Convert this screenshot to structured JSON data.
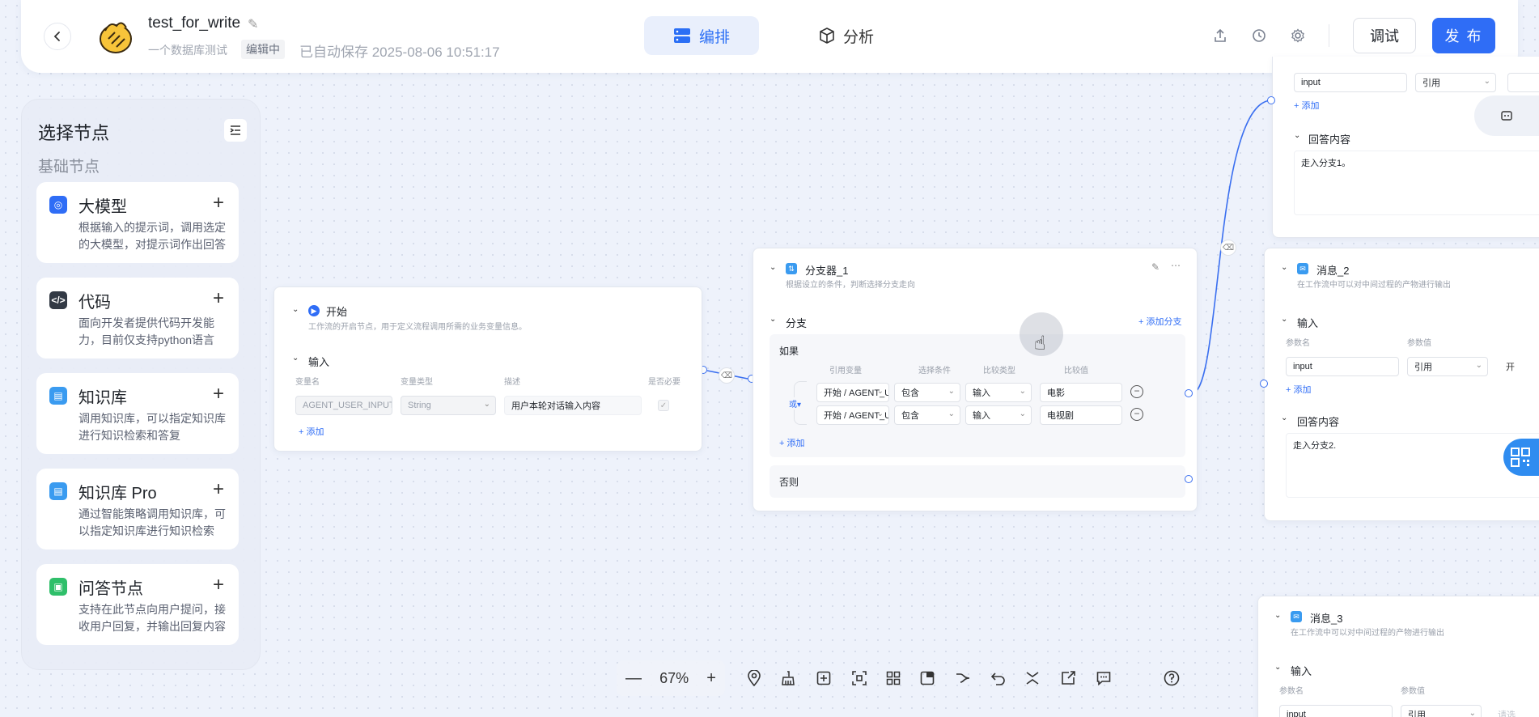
{
  "header": {
    "app_title": "test_for_write",
    "app_desc": "一个数据库测试",
    "status": "编辑中",
    "autosave": "已自动保存 2025-08-06 10:51:17",
    "tabs": [
      {
        "label": "编排",
        "active": true
      },
      {
        "label": "分析",
        "active": false
      }
    ],
    "debug_label": "调试",
    "publish_label": "发 布",
    "accent": "#2f6df6"
  },
  "panel": {
    "title": "选择节点",
    "section": "基础节点",
    "nodes": [
      {
        "name": "大模型",
        "desc": "根据输入的提示词，调用选定的大模型，对提示词作出回答",
        "icon": "llm-icon",
        "color": "#2f6df6"
      },
      {
        "name": "代码",
        "desc": "面向开发者提供代码开发能力，目前仅支持python语言",
        "icon": "code-icon",
        "color": "#333a45"
      },
      {
        "name": "知识库",
        "desc": "调用知识库，可以指定知识库进行知识检索和答复",
        "icon": "knowledge-icon",
        "color": "#3a9bf0"
      },
      {
        "name": "知识库 Pro",
        "desc": "通过智能策略调用知识库，可以指定知识库进行知识检索",
        "icon": "knowledge-pro-icon",
        "color": "#3a9bf0"
      },
      {
        "name": "问答节点",
        "desc": "支持在此节点向用户提问，接收用户回复，并输出回复内容",
        "icon": "qa-icon",
        "color": "#2fbf6a"
      }
    ]
  },
  "start_node": {
    "title": "开始",
    "desc": "工作流的开启节点，用于定义流程调用所需的业务变量信息。",
    "section": "输入",
    "headers": [
      "变量名",
      "变量类型",
      "描述",
      "是否必要"
    ],
    "row": {
      "name": "AGENT_USER_INPUT",
      "type": "String",
      "desc": "用户本轮对话输入内容"
    },
    "add": "添加"
  },
  "branch_node": {
    "title": "分支器_1",
    "desc": "根据设立的条件，判断选择分支走向",
    "section": "分支",
    "add_branch": "添加分支",
    "if_label": "如果",
    "headers": [
      "引用变量",
      "选择条件",
      "比较类型",
      "比较值"
    ],
    "logic": "或",
    "conditions": [
      {
        "var": "开始 / AGENT_USER_INPUT",
        "op": "包含",
        "type": "输入",
        "value": "电影"
      },
      {
        "var": "开始 / AGENT_USER_INPUT",
        "op": "包含",
        "type": "输入",
        "value": "电视剧"
      }
    ],
    "add": "添加",
    "else_label": "否则"
  },
  "msg1": {
    "input_value": "input",
    "ref": "引用",
    "add": "添加",
    "answer_label": "回答内容",
    "answer": "走入分支1。"
  },
  "msg2": {
    "title": "消息_2",
    "desc": "在工作流中可以对中间过程的产物进行输出",
    "section": "输入",
    "headers": [
      "参数名",
      "参数值"
    ],
    "input_value": "input",
    "ref": "引用",
    "extra": "开",
    "add": "添加",
    "answer_label": "回答内容",
    "answer": "走入分支2."
  },
  "msg3": {
    "title": "消息_3",
    "desc": "在工作流中可以对中间过程的产物进行输出",
    "section": "输入",
    "headers": [
      "参数名",
      "参数值"
    ],
    "input_value": "input",
    "ref": "引用",
    "extra": "请选"
  },
  "toolbar": {
    "zoom": "67%",
    "minus": "—",
    "plus": "+"
  }
}
